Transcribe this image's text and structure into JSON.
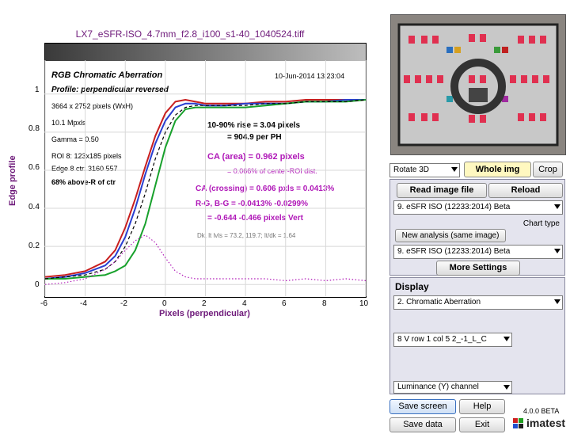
{
  "window": {
    "file_title": "LX7_eSFR-ISO_4.7mm_f2.8_i100_s1-40_1040524.tiff"
  },
  "plot": {
    "title": "RGB Chromatic Aberration",
    "profile": "Profile: perpendicular reversed",
    "timestamp": "10-Jun-2014 13:23:04",
    "info": [
      "3664 x 2752 pixels (WxH)",
      "10.1 Mpxls",
      "Gamma = 0.50",
      "ROI 8: 123x185 pixels",
      "Edge 8 ctr: 3160  557",
      "68% above-R of ctr"
    ],
    "rise_line1": "10-90% rise = 3.04 pixels",
    "rise_line2": "= 904.9 per PH",
    "ca_area": "CA (area) = 0.962 pixels",
    "ca_area_pct": "= 0.066% of center-ROI dist.",
    "ca_crossing": "CA (crossing) = 0.606 pxls = 0.0413%",
    "rg_bg": "R-G, B-G = -0.0413%  -0.0299%",
    "rg_bg_px": "= -0.644  -0.466 pixels Vert",
    "dk_lvls": "Dk, lt lvls = 73.2, 119.7;  lt/dk = 1.64",
    "ylabel": "Edge profile",
    "xlabel": "Pixels (perpendicular)",
    "yticks": [
      "1",
      "0.8",
      "0.6",
      "0.4",
      "0.2",
      "0"
    ],
    "xticks": [
      "-6",
      "-4",
      "-2",
      "0",
      "2",
      "4",
      "6",
      "8",
      "10"
    ]
  },
  "chart_data": {
    "type": "line",
    "title": "RGB Chromatic Aberration",
    "xlabel": "Pixels (perpendicular)",
    "ylabel": "Edge profile",
    "xlim": [
      -6,
      10
    ],
    "ylim": [
      -0.02,
      1.02
    ],
    "grid": true,
    "series": [
      {
        "color": "#c81e1e",
        "x": [
          -6,
          -5,
          -4,
          -3,
          -2.5,
          -2,
          -1.5,
          -1,
          -0.5,
          0,
          0.5,
          1,
          1.5,
          2,
          3,
          4,
          5,
          6,
          7,
          8,
          9,
          10
        ],
        "y": [
          0.04,
          0.05,
          0.07,
          0.12,
          0.18,
          0.3,
          0.45,
          0.62,
          0.78,
          0.9,
          0.96,
          0.97,
          0.96,
          0.95,
          0.95,
          0.95,
          0.96,
          0.96,
          0.97,
          0.97,
          0.97,
          0.97
        ]
      },
      {
        "color": "#2a3fd0",
        "x": [
          -6,
          -5,
          -4,
          -3,
          -2.5,
          -2,
          -1.5,
          -1,
          -0.5,
          0,
          0.5,
          1,
          1.5,
          2,
          3,
          4,
          5,
          6,
          7,
          8,
          9,
          10
        ],
        "y": [
          0.03,
          0.04,
          0.06,
          0.1,
          0.15,
          0.25,
          0.4,
          0.58,
          0.74,
          0.86,
          0.93,
          0.95,
          0.95,
          0.94,
          0.94,
          0.95,
          0.95,
          0.95,
          0.96,
          0.96,
          0.97,
          0.97
        ]
      },
      {
        "color": "#18a12c",
        "x": [
          -6,
          -5,
          -4,
          -3,
          -2.5,
          -2,
          -1.5,
          -1,
          -0.5,
          0,
          0.5,
          1,
          1.5,
          2,
          3,
          4,
          5,
          6,
          7,
          8,
          9,
          10
        ],
        "y": [
          0.03,
          0.03,
          0.04,
          0.05,
          0.07,
          0.1,
          0.18,
          0.32,
          0.52,
          0.72,
          0.86,
          0.92,
          0.93,
          0.93,
          0.93,
          0.93,
          0.94,
          0.95,
          0.96,
          0.96,
          0.96,
          0.97
        ]
      },
      {
        "color": "#000000",
        "dash": true,
        "x": [
          -6,
          -5,
          -4,
          -3,
          -2.5,
          -2,
          -1.5,
          -1,
          -0.5,
          0,
          0.5,
          1,
          1.5,
          2,
          3,
          4,
          5,
          6,
          7,
          8,
          9,
          10
        ],
        "y": [
          0.03,
          0.04,
          0.05,
          0.08,
          0.12,
          0.2,
          0.32,
          0.48,
          0.66,
          0.8,
          0.89,
          0.93,
          0.94,
          0.94,
          0.94,
          0.94,
          0.95,
          0.95,
          0.96,
          0.96,
          0.96,
          0.97
        ]
      },
      {
        "color": "#b018b8",
        "dotted": true,
        "x": [
          -6,
          -5,
          -4,
          -3,
          -2.5,
          -2,
          -1.5,
          -1,
          -0.5,
          0,
          0.5,
          1,
          1.5,
          2,
          3,
          4,
          5,
          6,
          7,
          8,
          9,
          10
        ],
        "y": [
          0.0,
          0.01,
          0.03,
          0.08,
          0.12,
          0.18,
          0.23,
          0.26,
          0.22,
          0.14,
          0.07,
          0.04,
          0.03,
          0.03,
          0.03,
          0.03,
          0.03,
          0.02,
          0.03,
          0.02,
          0.03,
          0.02
        ]
      }
    ]
  },
  "right_panel": {
    "rotate_select": "Rotate 3D",
    "whole_img": "Whole img",
    "crop": "Crop",
    "read_image": "Read image file",
    "reload": "Reload",
    "chart_select": "9. eSFR ISO  (12233:2014)  Beta",
    "new_analysis": "New analysis (same image)",
    "chart_type_label": "Chart type",
    "chart_type_select": "9. eSFR ISO  (12233:2014)  Beta",
    "more_settings": "More Settings",
    "display_label": "Display",
    "display_select": "2.   Chromatic Aberration",
    "roi_select": "8  V row 1 col 5   2_-1_L_C",
    "channel_select": "Luminance (Y) channel",
    "save_screen": "Save screen",
    "help": "Help",
    "save_data": "Save data",
    "exit": "Exit",
    "version": "4.0.0 BETA",
    "brand": "imatest"
  },
  "colors": {
    "accent": "#6e1a7a",
    "magenta": "#b018b8"
  }
}
